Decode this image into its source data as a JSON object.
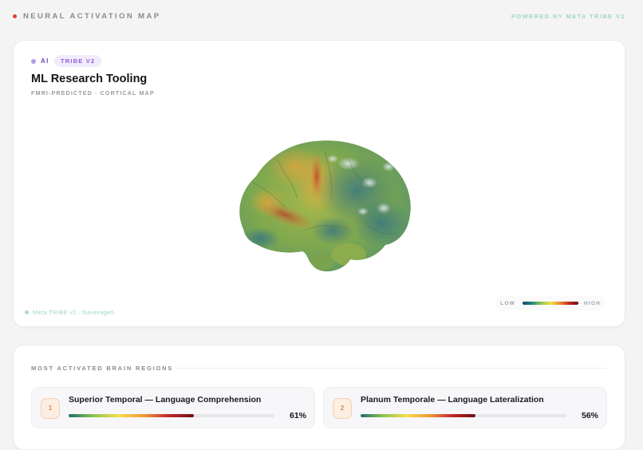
{
  "topbar": {
    "title": "NEURAL ACTIVATION MAP",
    "powered_by": "POWERED BY META TRIBE V2"
  },
  "main_card": {
    "tag_ai": "AI",
    "tag_model": "TRIBE V2",
    "title": "ML Research Tooling",
    "subtitle": "FMRI-PREDICTED · CORTICAL MAP",
    "footer_model": "Meta TRIBE v2 · fsaverage5",
    "legend": {
      "low": "LOW",
      "high": "HIGH"
    }
  },
  "regions": {
    "section_title": "MOST ACTIVATED BRAIN REGIONS",
    "items": [
      {
        "rank": "1",
        "name": "Superior Temporal — Language Comprehension",
        "percent_label": "61%",
        "value": 0.61
      },
      {
        "rank": "2",
        "name": "Planum Temporale — Language Lateralization",
        "percent_label": "56%",
        "value": 0.56
      }
    ]
  },
  "colors": {
    "accent_red": "#e0413a",
    "accent_purple": "#8d5fd6",
    "accent_mint": "#9fd6c6"
  }
}
